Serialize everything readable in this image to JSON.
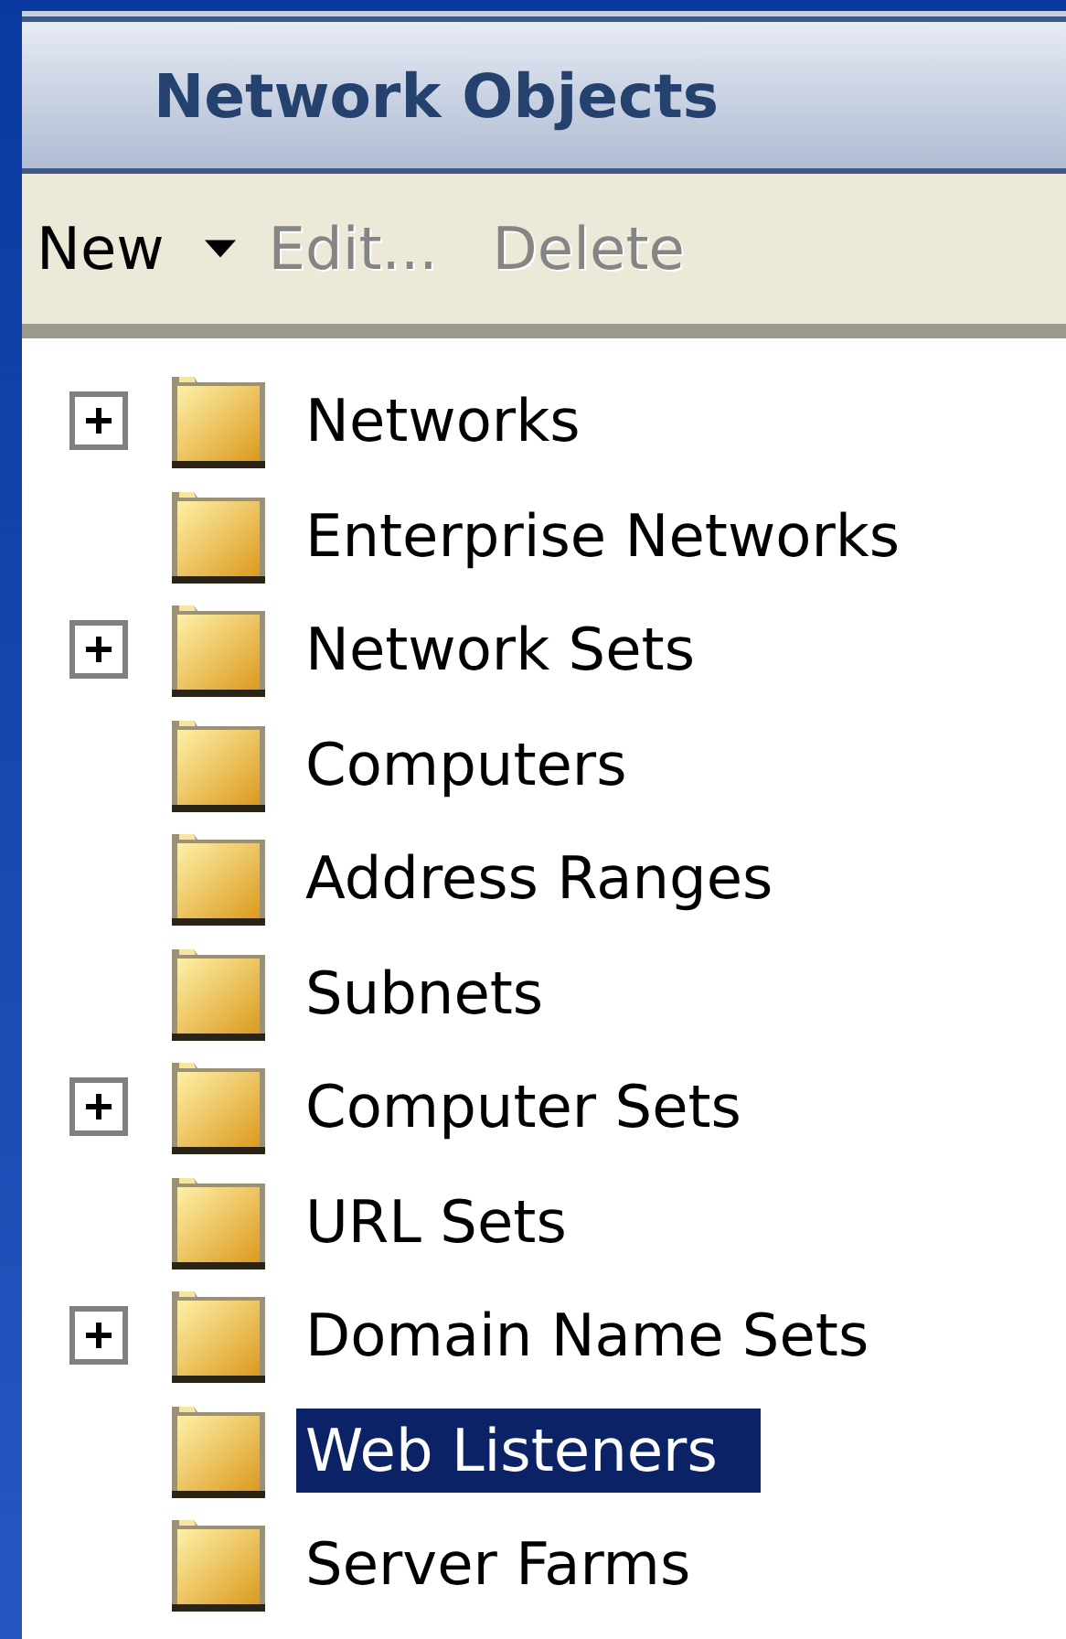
{
  "panel": {
    "title": "Network Objects"
  },
  "toolbar": [
    {
      "label": "New",
      "disabled": false,
      "dropdown": true
    },
    {
      "label": "Edit...",
      "disabled": true,
      "dropdown": false
    },
    {
      "label": "Delete",
      "disabled": true,
      "dropdown": false
    }
  ],
  "tree": [
    {
      "label": "Networks",
      "expandable": true,
      "selected": false
    },
    {
      "label": "Enterprise Networks",
      "expandable": false,
      "selected": false
    },
    {
      "label": "Network Sets",
      "expandable": true,
      "selected": false
    },
    {
      "label": "Computers",
      "expandable": false,
      "selected": false
    },
    {
      "label": "Address Ranges",
      "expandable": false,
      "selected": false
    },
    {
      "label": "Subnets",
      "expandable": false,
      "selected": false
    },
    {
      "label": "Computer Sets",
      "expandable": true,
      "selected": false
    },
    {
      "label": "URL Sets",
      "expandable": false,
      "selected": false
    },
    {
      "label": "Domain Name Sets",
      "expandable": true,
      "selected": false
    },
    {
      "label": "Web Listeners",
      "expandable": false,
      "selected": true
    },
    {
      "label": "Server Farms",
      "expandable": false,
      "selected": false
    }
  ]
}
